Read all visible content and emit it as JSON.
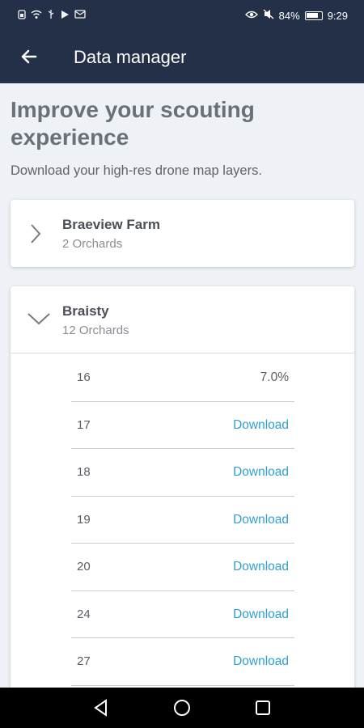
{
  "status_bar": {
    "left_icons": [
      "sim-icon",
      "wifi-icon",
      "usb-icon",
      "play-icon",
      "message-icon"
    ],
    "battery_percent_label": "84%",
    "battery_level": 0.84,
    "time": "9:29"
  },
  "app_bar": {
    "title": "Data manager"
  },
  "page": {
    "heading": "Improve your scouting experience",
    "subtitle": "Download your high-res drone map layers."
  },
  "farms": [
    {
      "name": "Braeview Farm",
      "sub": "2 Orchards",
      "expanded": false
    },
    {
      "name": "Braisty",
      "sub": "12 Orchards",
      "expanded": true,
      "orchards": [
        {
          "number": "16",
          "action": "7.0%",
          "progress": 0.07
        },
        {
          "number": "17",
          "action": "Download"
        },
        {
          "number": "18",
          "action": "Download"
        },
        {
          "number": "19",
          "action": "Download"
        },
        {
          "number": "20",
          "action": "Download"
        },
        {
          "number": "24",
          "action": "Download"
        },
        {
          "number": "27",
          "action": "Download"
        }
      ]
    }
  ],
  "colors": {
    "header_bg": "#233047",
    "link": "#2fa0d4",
    "page_bg": "#eef2f7"
  }
}
